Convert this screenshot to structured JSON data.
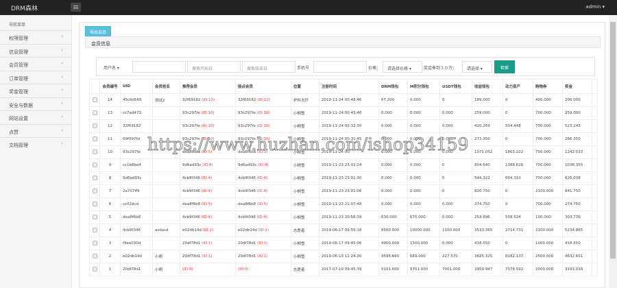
{
  "header": {
    "brand": "DRM森林",
    "user": "admin ▾"
  },
  "sidebar": {
    "title": "导航菜单",
    "items": [
      {
        "label": "权限管理"
      },
      {
        "label": "信息管理"
      },
      {
        "label": "会员管理"
      },
      {
        "label": "订单管理"
      },
      {
        "label": "奖金管理"
      },
      {
        "label": "安全与数据"
      },
      {
        "label": "网站设置"
      },
      {
        "label": "点赞"
      },
      {
        "label": "文档管理"
      }
    ]
  },
  "panel": {
    "export_label": "导出会员",
    "title": "会员信息"
  },
  "filters": {
    "field_select": "用户名 ▾",
    "start_placeholder": "搜索开始日",
    "end_placeholder": "搜索结束日",
    "phone_label": "手机号",
    "price_label": "价格：",
    "price_select": "请选择价格 ▾",
    "bonus_label": "奖金奉到３０万：",
    "bonus_select": "请选择 ▾",
    "search_label": "检索"
  },
  "table": {
    "columns": [
      "会员编号",
      "UID",
      "会员姓名",
      "推荐会员",
      "接点会员",
      "位置",
      "注册时间",
      "DRM钱包",
      "M积分钱包",
      "USDT钱包",
      "收益钱包",
      "动力资产",
      "购物券",
      "奖金"
    ],
    "rows": [
      [
        "14",
        "45c9d565",
        "测试2",
        "32f69182",
        "(ID:12)",
        "32f69182",
        "(ID:12)",
        "炉科大仔",
        "2019-11-24 00:48:46",
        "67.200",
        "0.000",
        "0",
        "189.000",
        "0",
        "400.000",
        "206.000"
      ],
      [
        "13",
        "cc7ad473",
        "",
        "93c297fe",
        "(ID:10)",
        "93c297fe",
        "(ID:10)",
        "小桐雪",
        "2019-11-24 00:43:46",
        "0.000",
        "0.000",
        "0.000",
        "259.000",
        "0",
        "700.000",
        "259.000"
      ],
      [
        "12",
        "32f69182",
        "",
        "93c297fe",
        "(ID:10)",
        "93c297fe",
        "(ID:10)",
        "小桐雪",
        "2019-11-24 00:32:30",
        "0.000",
        "0.000",
        "0.000",
        "420.269",
        "504.448",
        "700.000",
        "523.245"
      ],
      [
        "11",
        "09f097fd",
        "",
        "93c297fe",
        "(ID:10)",
        "93c297fe",
        "(ID:10)",
        "小桐雪",
        "2019-11-24 00:31:45",
        "0.000",
        "0.000",
        "0.000",
        "273.350",
        "0",
        "700.000",
        "266.350"
      ],
      [
        "10",
        "93c297fe",
        "",
        "dea8f6b8",
        "(ID:5)",
        "dea8f6b8",
        "(ID:5)",
        "小桐雪",
        "2019-11-24 00:",
        "0.000",
        "0.000",
        "0.000",
        "1071.052",
        "1803.222",
        "700.000",
        "1242.533"
      ],
      [
        "9",
        "cc1b8be4",
        "",
        "9d6ad93c",
        "(ID:8)",
        "9d6ad93c",
        "(ID:8)",
        "小桐雪",
        "2019-11-23 23:02:24",
        "0.000",
        "0.000",
        "0",
        "804.640",
        "1388.626",
        "700.000",
        "1038.355"
      ],
      [
        "8",
        "9d6ad93c",
        "",
        "4cb9f346",
        "(ID:4)",
        "4cb9f346",
        "(ID:4)",
        "小桐雪",
        "2019-11-23 23:01:30",
        "0.000",
        "0.000",
        "0",
        "544.322",
        "604.310",
        "700.000",
        "626.038"
      ],
      [
        "7",
        "2a707ff9",
        "",
        "4cb9f346",
        "(ID:4)",
        "4cb9f346",
        "(ID:4)",
        "小桐雪",
        "2019-11-23 23:01:06",
        "0.000",
        "0.000",
        "0",
        "820.750",
        "0",
        "2100.000",
        "841.750"
      ],
      [
        "6",
        "cc02dcd",
        "",
        "dea8f6b8",
        "(ID:5)",
        "dea8f6b8",
        "(ID:5)",
        "小桐雪",
        "2019-11-23 21:07:48",
        "0.000",
        "0.000",
        "0.000",
        "274.750",
        "0",
        "700.000",
        "274.750"
      ],
      [
        "5",
        "dea8f6b8",
        "",
        "4cb9f346",
        "(ID:4)",
        "4cb9f346",
        "(ID:4)",
        "小桐雪",
        "2019-11-23 20:56:39",
        "630.000",
        "670.000",
        "0.000",
        "253.896",
        "508.524",
        "100.000",
        "303.776"
      ],
      [
        "4",
        "4cb9f346",
        "asdasd",
        "e02db14d",
        "(ID:2)",
        "e02db14d",
        "(ID:2)",
        "志愿者",
        "2019-06-17 09:55:18",
        "8560.000",
        "10000.000",
        "1100.000",
        "3533.365",
        "2714.731",
        "2100.000",
        "5234.865"
      ],
      [
        "3",
        "f9ee030d",
        "",
        "20df78d1",
        "(ID:1)",
        "20df78d1",
        "(ID:1)",
        "小桐雪",
        "2019-06-17 09:45:06",
        "4900.000",
        "1500.000",
        "0.000",
        "418.550",
        "0",
        "1000.000",
        "418.550"
      ],
      [
        "2",
        "e02db14d",
        "小明",
        "20df78d1",
        "(ID:1)",
        "20df78d1",
        "(ID:1)",
        "小桐雪",
        "2019-06-13 11:24:30",
        "4595.660",
        "669.000",
        "227.570",
        "3825.325",
        "8182.137",
        "2500.000",
        "4632.601"
      ],
      [
        "1",
        "20df78d1",
        "小明",
        "",
        "(ID:0)",
        "",
        "(ID:0)",
        "志愿者",
        "2017-07-19 09:45:39",
        "5101.000",
        "6701.000",
        "7001.000",
        "2959.947",
        "7378.592",
        "2000.000",
        "3193.018"
      ]
    ]
  },
  "watermark": "https://www.huzhan.com/ishop34159",
  "colors": {
    "topbar": "#222222",
    "export": "#5bc0de",
    "search": "#1a9c8a",
    "id_red": "#ff3333"
  }
}
